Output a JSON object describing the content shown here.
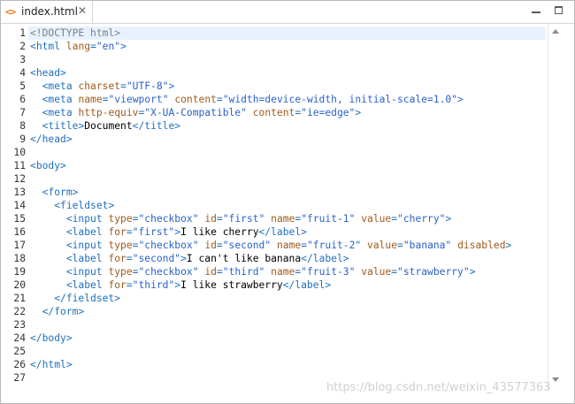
{
  "tab": {
    "icon": "code-brackets-icon",
    "icon_glyph": "<>",
    "title": "index.html",
    "close_glyph": "✕"
  },
  "window_controls": [
    "minimize",
    "maximize"
  ],
  "editor": {
    "current_line": 1,
    "lines": [
      {
        "n": "1",
        "tokens": [
          [
            "d",
            "<!DOCTYPE html>"
          ]
        ]
      },
      {
        "n": "2",
        "tokens": [
          [
            "p",
            "<"
          ],
          [
            "t",
            "html"
          ],
          [
            "tx",
            " "
          ],
          [
            "a",
            "lang"
          ],
          [
            "p",
            "="
          ],
          [
            "v",
            "\"en\""
          ],
          [
            "p",
            ">"
          ]
        ]
      },
      {
        "n": "3",
        "tokens": []
      },
      {
        "n": "4",
        "tokens": [
          [
            "p",
            "<"
          ],
          [
            "t",
            "head"
          ],
          [
            "p",
            ">"
          ]
        ]
      },
      {
        "n": "5",
        "tokens": [
          [
            "tx",
            "  "
          ],
          [
            "p",
            "<"
          ],
          [
            "t",
            "meta"
          ],
          [
            "tx",
            " "
          ],
          [
            "a",
            "charset"
          ],
          [
            "p",
            "="
          ],
          [
            "v",
            "\"UTF-8\""
          ],
          [
            "p",
            ">"
          ]
        ]
      },
      {
        "n": "6",
        "tokens": [
          [
            "tx",
            "  "
          ],
          [
            "p",
            "<"
          ],
          [
            "t",
            "meta"
          ],
          [
            "tx",
            " "
          ],
          [
            "a",
            "name"
          ],
          [
            "p",
            "="
          ],
          [
            "v",
            "\"viewport\""
          ],
          [
            "tx",
            " "
          ],
          [
            "a",
            "content"
          ],
          [
            "p",
            "="
          ],
          [
            "v",
            "\"width=device-width, initial-scale=1.0\""
          ],
          [
            "p",
            ">"
          ]
        ]
      },
      {
        "n": "7",
        "tokens": [
          [
            "tx",
            "  "
          ],
          [
            "p",
            "<"
          ],
          [
            "t",
            "meta"
          ],
          [
            "tx",
            " "
          ],
          [
            "a",
            "http-equiv"
          ],
          [
            "p",
            "="
          ],
          [
            "v",
            "\"X-UA-Compatible\""
          ],
          [
            "tx",
            " "
          ],
          [
            "a",
            "content"
          ],
          [
            "p",
            "="
          ],
          [
            "v",
            "\"ie=edge\""
          ],
          [
            "p",
            ">"
          ]
        ]
      },
      {
        "n": "8",
        "tokens": [
          [
            "tx",
            "  "
          ],
          [
            "p",
            "<"
          ],
          [
            "t",
            "title"
          ],
          [
            "p",
            ">"
          ],
          [
            "tx",
            "Document"
          ],
          [
            "p",
            "</"
          ],
          [
            "t",
            "title"
          ],
          [
            "p",
            ">"
          ]
        ]
      },
      {
        "n": "9",
        "tokens": [
          [
            "p",
            "</"
          ],
          [
            "t",
            "head"
          ],
          [
            "p",
            ">"
          ]
        ]
      },
      {
        "n": "10",
        "tokens": []
      },
      {
        "n": "11",
        "tokens": [
          [
            "p",
            "<"
          ],
          [
            "t",
            "body"
          ],
          [
            "p",
            ">"
          ]
        ]
      },
      {
        "n": "12",
        "tokens": []
      },
      {
        "n": "13",
        "tokens": [
          [
            "tx",
            "  "
          ],
          [
            "p",
            "<"
          ],
          [
            "t",
            "form"
          ],
          [
            "p",
            ">"
          ]
        ]
      },
      {
        "n": "14",
        "tokens": [
          [
            "tx",
            "    "
          ],
          [
            "p",
            "<"
          ],
          [
            "t",
            "fieldset"
          ],
          [
            "p",
            ">"
          ]
        ]
      },
      {
        "n": "15",
        "tokens": [
          [
            "tx",
            "      "
          ],
          [
            "p",
            "<"
          ],
          [
            "t",
            "input"
          ],
          [
            "tx",
            " "
          ],
          [
            "a",
            "type"
          ],
          [
            "p",
            "="
          ],
          [
            "v",
            "\"checkbox\""
          ],
          [
            "tx",
            " "
          ],
          [
            "a",
            "id"
          ],
          [
            "p",
            "="
          ],
          [
            "v",
            "\"first\""
          ],
          [
            "tx",
            " "
          ],
          [
            "a",
            "name"
          ],
          [
            "p",
            "="
          ],
          [
            "v",
            "\"fruit-1\""
          ],
          [
            "tx",
            " "
          ],
          [
            "a",
            "value"
          ],
          [
            "p",
            "="
          ],
          [
            "v",
            "\"cherry\""
          ],
          [
            "p",
            ">"
          ]
        ]
      },
      {
        "n": "16",
        "tokens": [
          [
            "tx",
            "      "
          ],
          [
            "p",
            "<"
          ],
          [
            "t",
            "label"
          ],
          [
            "tx",
            " "
          ],
          [
            "a",
            "for"
          ],
          [
            "p",
            "="
          ],
          [
            "v",
            "\"first\""
          ],
          [
            "p",
            ">"
          ],
          [
            "tx",
            "I like cherry"
          ],
          [
            "p",
            "</"
          ],
          [
            "t",
            "label"
          ],
          [
            "p",
            ">"
          ]
        ]
      },
      {
        "n": "17",
        "tokens": [
          [
            "tx",
            "      "
          ],
          [
            "p",
            "<"
          ],
          [
            "t",
            "input"
          ],
          [
            "tx",
            " "
          ],
          [
            "a",
            "type"
          ],
          [
            "p",
            "="
          ],
          [
            "v",
            "\"checkbox\""
          ],
          [
            "tx",
            " "
          ],
          [
            "a",
            "id"
          ],
          [
            "p",
            "="
          ],
          [
            "v",
            "\"second\""
          ],
          [
            "tx",
            " "
          ],
          [
            "a",
            "name"
          ],
          [
            "p",
            "="
          ],
          [
            "v",
            "\"fruit-2\""
          ],
          [
            "tx",
            " "
          ],
          [
            "a",
            "value"
          ],
          [
            "p",
            "="
          ],
          [
            "v",
            "\"banana\""
          ],
          [
            "tx",
            " "
          ],
          [
            "a",
            "disabled"
          ],
          [
            "p",
            ">"
          ]
        ]
      },
      {
        "n": "18",
        "tokens": [
          [
            "tx",
            "      "
          ],
          [
            "p",
            "<"
          ],
          [
            "t",
            "label"
          ],
          [
            "tx",
            " "
          ],
          [
            "a",
            "for"
          ],
          [
            "p",
            "="
          ],
          [
            "v",
            "\"second\""
          ],
          [
            "p",
            ">"
          ],
          [
            "tx",
            "I can't like banana"
          ],
          [
            "p",
            "</"
          ],
          [
            "t",
            "label"
          ],
          [
            "p",
            ">"
          ]
        ]
      },
      {
        "n": "19",
        "tokens": [
          [
            "tx",
            "      "
          ],
          [
            "p",
            "<"
          ],
          [
            "t",
            "input"
          ],
          [
            "tx",
            " "
          ],
          [
            "a",
            "type"
          ],
          [
            "p",
            "="
          ],
          [
            "v",
            "\"checkbox\""
          ],
          [
            "tx",
            " "
          ],
          [
            "a",
            "id"
          ],
          [
            "p",
            "="
          ],
          [
            "v",
            "\"third\""
          ],
          [
            "tx",
            " "
          ],
          [
            "a",
            "name"
          ],
          [
            "p",
            "="
          ],
          [
            "v",
            "\"fruit-3\""
          ],
          [
            "tx",
            " "
          ],
          [
            "a",
            "value"
          ],
          [
            "p",
            "="
          ],
          [
            "v",
            "\"strawberry\""
          ],
          [
            "p",
            ">"
          ]
        ]
      },
      {
        "n": "20",
        "tokens": [
          [
            "tx",
            "      "
          ],
          [
            "p",
            "<"
          ],
          [
            "t",
            "label"
          ],
          [
            "tx",
            " "
          ],
          [
            "a",
            "for"
          ],
          [
            "p",
            "="
          ],
          [
            "v",
            "\"third\""
          ],
          [
            "p",
            ">"
          ],
          [
            "tx",
            "I like strawberry"
          ],
          [
            "p",
            "</"
          ],
          [
            "t",
            "label"
          ],
          [
            "p",
            ">"
          ]
        ]
      },
      {
        "n": "21",
        "tokens": [
          [
            "tx",
            "    "
          ],
          [
            "p",
            "</"
          ],
          [
            "t",
            "fieldset"
          ],
          [
            "p",
            ">"
          ]
        ]
      },
      {
        "n": "22",
        "tokens": [
          [
            "tx",
            "  "
          ],
          [
            "p",
            "</"
          ],
          [
            "t",
            "form"
          ],
          [
            "p",
            ">"
          ]
        ]
      },
      {
        "n": "23",
        "tokens": []
      },
      {
        "n": "24",
        "tokens": [
          [
            "p",
            "</"
          ],
          [
            "t",
            "body"
          ],
          [
            "p",
            ">"
          ]
        ]
      },
      {
        "n": "25",
        "tokens": []
      },
      {
        "n": "26",
        "tokens": [
          [
            "p",
            "</"
          ],
          [
            "t",
            "html"
          ],
          [
            "p",
            ">"
          ]
        ]
      },
      {
        "n": "27",
        "tokens": []
      }
    ]
  },
  "watermark": "https://blog.csdn.net/weixin_43577363",
  "colors": {
    "tag": "#1f6fbf",
    "attribute": "#a05a1b",
    "value": "#2a62c7",
    "doctype": "#7f7f7f",
    "current_line_highlight": "#e8f2fe",
    "tab_icon": "#e8731a"
  }
}
